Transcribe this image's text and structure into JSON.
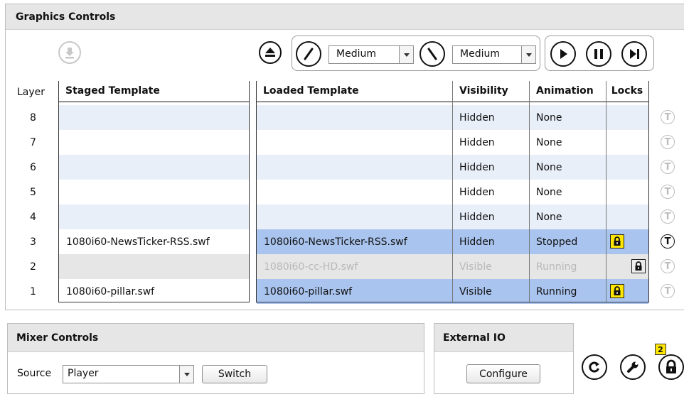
{
  "graphics": {
    "title": "Graphics Controls",
    "fill_dropdown": {
      "value": "Medium"
    },
    "clear_dropdown": {
      "value": "Medium"
    },
    "columns": {
      "layer": "Layer",
      "staged": "Staged Template",
      "loaded": "Loaded Template",
      "visibility": "Visibility",
      "animation": "Animation",
      "locks": "Locks"
    },
    "rows": [
      {
        "layer": "8",
        "staged": "",
        "loaded": "",
        "visibility": "Hidden",
        "animation": "None",
        "lock": "none",
        "style": "light"
      },
      {
        "layer": "7",
        "staged": "",
        "loaded": "",
        "visibility": "Hidden",
        "animation": "None",
        "lock": "none",
        "style": "white"
      },
      {
        "layer": "6",
        "staged": "",
        "loaded": "",
        "visibility": "Hidden",
        "animation": "None",
        "lock": "none",
        "style": "light"
      },
      {
        "layer": "5",
        "staged": "",
        "loaded": "",
        "visibility": "Hidden",
        "animation": "None",
        "lock": "none",
        "style": "white"
      },
      {
        "layer": "4",
        "staged": "",
        "loaded": "",
        "visibility": "Hidden",
        "animation": "None",
        "lock": "none",
        "style": "light"
      },
      {
        "layer": "3",
        "staged": "1080i60-NewsTicker-RSS.swf",
        "loaded": "1080i60-NewsTicker-RSS.swf",
        "visibility": "Hidden",
        "animation": "Stopped",
        "lock": "yellow",
        "style": "selected"
      },
      {
        "layer": "2",
        "staged": "",
        "loaded": "1080i60-cc-HD.swf",
        "visibility": "Visible",
        "animation": "Running",
        "lock": "grey",
        "style": "disabled"
      },
      {
        "layer": "1",
        "staged": "1080i60-pillar.swf",
        "loaded": "1080i60-pillar.swf",
        "visibility": "Visible",
        "animation": "Running",
        "lock": "yellow",
        "style": "selected"
      }
    ]
  },
  "mixer": {
    "title": "Mixer Controls",
    "source_label": "Source",
    "source_value": "Player",
    "switch_label": "Switch"
  },
  "external_io": {
    "title": "External IO",
    "configure_label": "Configure"
  },
  "lock_badge": "2",
  "colors": {
    "light_row": "#e9eff9",
    "selected_row": "#a9c4ee",
    "disabled_row": "#e6e6e6",
    "lock_yellow": "#ffe600"
  }
}
